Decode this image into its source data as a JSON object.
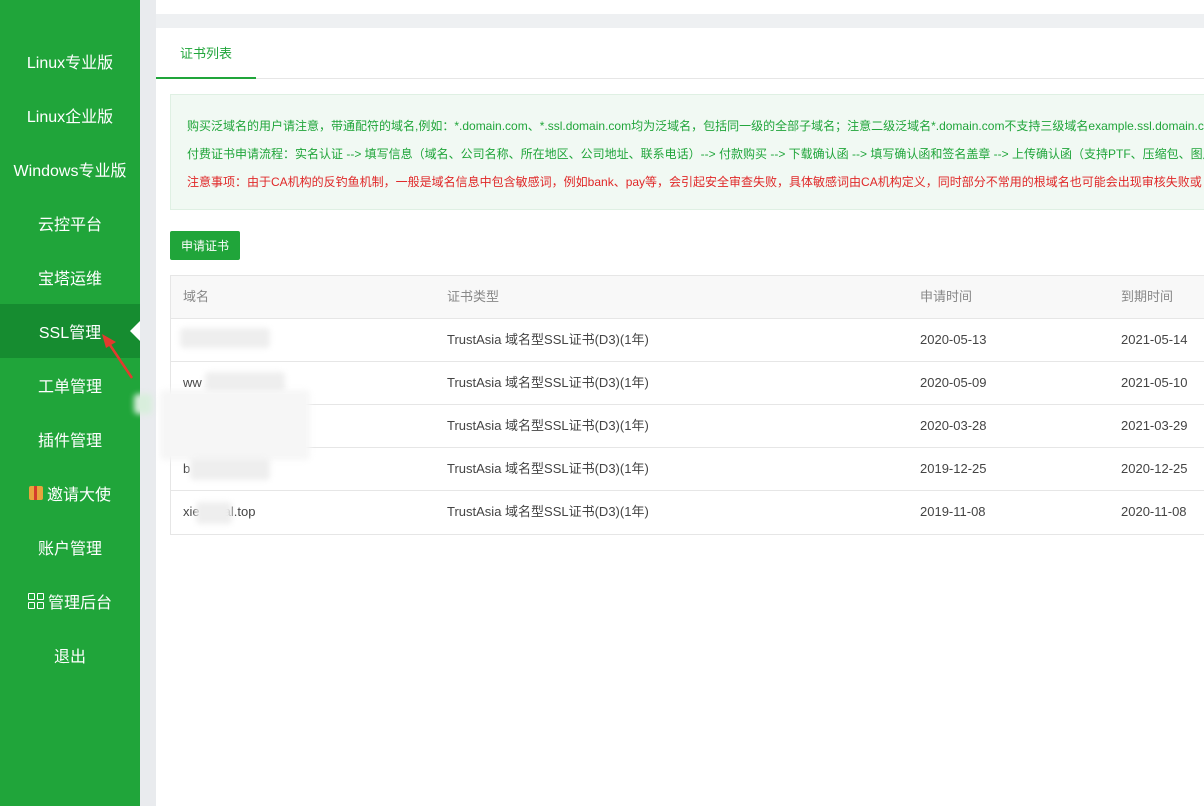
{
  "sidebar": {
    "items": [
      {
        "label": "Linux专业版",
        "icon": ""
      },
      {
        "label": "Linux企业版",
        "icon": ""
      },
      {
        "label": "Windows专业版",
        "icon": ""
      },
      {
        "label": "云控平台",
        "icon": ""
      },
      {
        "label": "宝塔运维",
        "icon": ""
      },
      {
        "label": "SSL管理",
        "icon": "",
        "active": true
      },
      {
        "label": "工单管理",
        "icon": ""
      },
      {
        "label": "插件管理",
        "icon": ""
      },
      {
        "label": "邀请大使",
        "icon": "gift-icon"
      },
      {
        "label": "账户管理",
        "icon": ""
      },
      {
        "label": "管理后台",
        "icon": "grid-icon"
      },
      {
        "label": "退出",
        "icon": ""
      }
    ]
  },
  "tabs": [
    {
      "label": "证书列表",
      "active": true
    }
  ],
  "notice": {
    "line1": "购买泛域名的用户请注意，带通配符的域名,例如：*.domain.com、*.ssl.domain.com均为泛域名，包括同一级的全部子域名；注意二级泛域名*.domain.com不支持三级域名example.ssl.domain.com",
    "line2": "付费证书申请流程：实名认证 --> 填写信息（域名、公司名称、所在地区、公司地址、联系电话）--> 付款购买 --> 下载确认函 --> 填写确认函和签名盖章 --> 上传确认函（支持PTF、压缩包、图片）",
    "line3": "注意事项：由于CA机构的反钓鱼机制，一般是域名信息中包含敏感词，例如bank、pay等，会引起安全审查失败，具体敏感词由CA机构定义，同时部分不常用的根域名也可能会出现审核失败或"
  },
  "apply_button": "申请证书",
  "table": {
    "headers": [
      "域名",
      "证书类型",
      "申请时间",
      "到期时间"
    ],
    "rows": [
      [
        "",
        "TrustAsia 域名型SSL证书(D3)(1年)",
        "2020-05-13",
        "2021-05-14"
      ],
      [
        "ww",
        "TrustAsia 域名型SSL证书(D3)(1年)",
        "2020-05-09",
        "2021-05-10"
      ],
      [
        "",
        "TrustAsia 域名型SSL证书(D3)(1年)",
        "2020-03-28",
        "2021-03-29"
      ],
      [
        "b",
        "TrustAsia 域名型SSL证书(D3)(1年)",
        "2019-12-25",
        "2020-12-25"
      ],
      [
        "xie",
        "TrustAsia 域名型SSL证书(D3)(1年)",
        "2019-11-08",
        "2020-11-08"
      ]
    ],
    "last_row_domain_suffix": "al.top"
  },
  "colors": {
    "brand": "#20a53a",
    "warning": "#e02828"
  }
}
